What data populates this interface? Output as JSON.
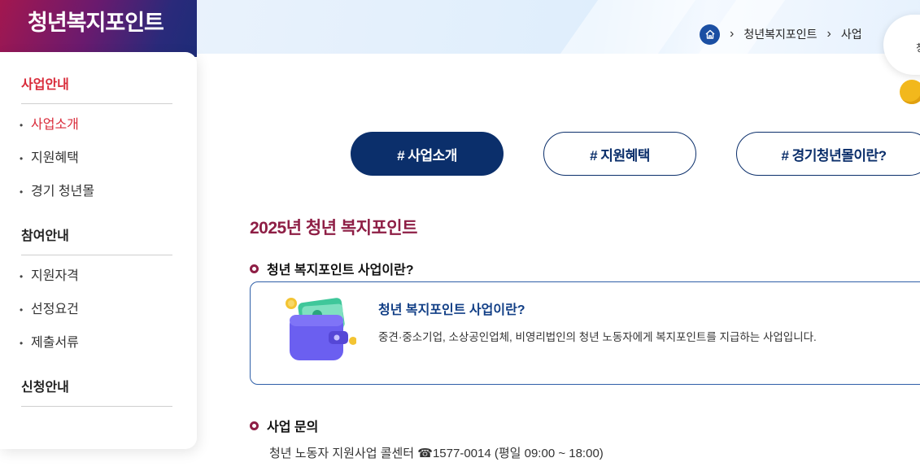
{
  "brand": {
    "title": "청년복지포인트"
  },
  "sidebar": {
    "groups": [
      {
        "heading": "사업안내",
        "items": [
          "사업소개",
          "지원혜택",
          "경기 청년몰"
        ]
      },
      {
        "heading": "참여안내",
        "items": [
          "지원자격",
          "선정요건",
          "제출서류"
        ]
      },
      {
        "heading": "신청안내",
        "items": []
      }
    ]
  },
  "breadcrumb": {
    "items": [
      "청년복지포인트",
      "사업"
    ]
  },
  "float_widget": {
    "text": "청"
  },
  "tabs": [
    "# 사업소개",
    "# 지원혜택",
    "# 경기청년몰이란?"
  ],
  "main": {
    "title": "2025년 청년 복지포인트",
    "section1": {
      "heading": "청년 복지포인트 사업이란?",
      "box_title": "청년 복지포인트 사업이란?",
      "box_desc": "중견·중소기업, 소상공인업체, 비영리법인의 청년 노동자에게 복지포인트를 지급하는 사업입니다."
    },
    "section2": {
      "heading": "사업 문의",
      "contact": "청년 노동자 지원사업 콜센터 ☎1577-0014 (평일 09:00 ~ 18:00)"
    }
  },
  "colors": {
    "accent": "#8e1e45",
    "navy": "#0b2f6b",
    "active_red": "#d92b3a",
    "link_blue": "#123f86"
  }
}
